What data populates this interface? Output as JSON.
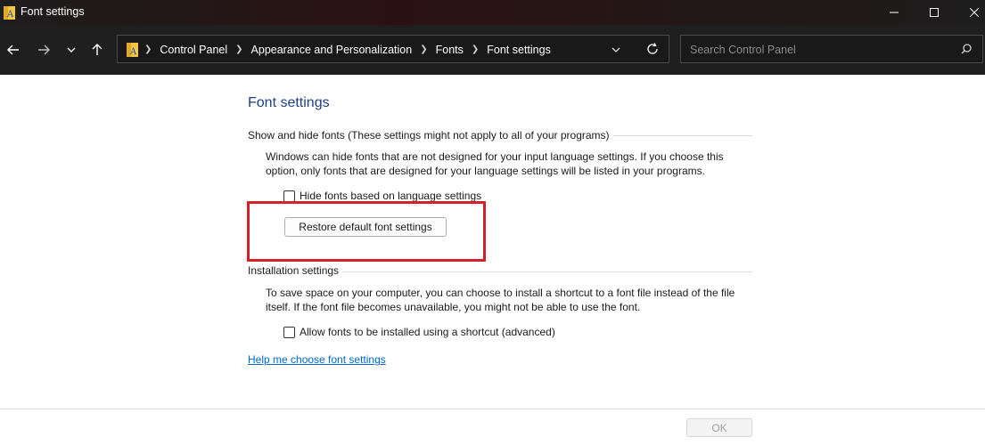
{
  "window": {
    "title": "Font settings"
  },
  "nav": {
    "breadcrumbs": [
      "Control Panel",
      "Appearance and Personalization",
      "Fonts",
      "Font settings"
    ],
    "search_placeholder": "Search Control Panel"
  },
  "content": {
    "heading": "Font settings",
    "show_hide": {
      "title": "Show and hide fonts (These settings might not apply to all of your programs)",
      "description": "Windows can hide fonts that are not designed for your input language settings. If you choose this option, only fonts that are designed for your language settings will be listed in your programs.",
      "checkbox_label": "Hide fonts based on language settings",
      "checked": false,
      "restore_button": "Restore default font settings"
    },
    "installation": {
      "title": "Installation settings",
      "description": "To save space on your computer, you can choose to install a shortcut to a font file instead of the file itself. If the font file becomes unavailable, you might not be able to use the font.",
      "checkbox_label": "Allow fonts to be installed using a shortcut (advanced)",
      "checked": false
    },
    "help_link": "Help me choose font settings"
  },
  "footer": {
    "ok_button": "OK"
  },
  "colors": {
    "highlight": "#d4202a",
    "heading": "#1f3f86",
    "link": "#0066cc"
  }
}
